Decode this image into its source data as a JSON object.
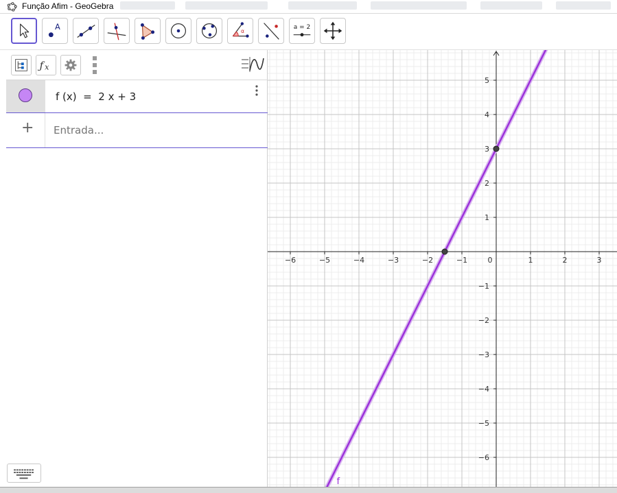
{
  "window": {
    "title": "Função Afim - GeoGebra"
  },
  "toolbar": {
    "tools": [
      "move",
      "point",
      "line",
      "perpendicular-line",
      "polygon",
      "circle-center-point",
      "circle-three-points",
      "angle",
      "reflect-about-line",
      "slider",
      "move-graphics-view"
    ],
    "slider_tool_label": "a = 2"
  },
  "algebra": {
    "objects": [
      {
        "color": "#c586f5",
        "formula": "f (x)  =  2 x + 3"
      }
    ],
    "input_placeholder": "Entrada...",
    "add_symbol": "+"
  },
  "graphics": {
    "function_label": "f",
    "x_ticks": [
      "−6",
      "−5",
      "−4",
      "−3",
      "−2",
      "−1",
      "0",
      "1",
      "2",
      "3"
    ],
    "y_ticks_pos": [
      "5",
      "4",
      "3",
      "2",
      "1"
    ],
    "y_ticks_neg": [
      "−1",
      "−2",
      "−3",
      "−4",
      "−5",
      "−6"
    ],
    "line_color": "#9b30d9",
    "chart_data": {
      "type": "line",
      "function": "2x + 3",
      "slope": 2,
      "intercept": 3,
      "xlim": [
        -6.5,
        3.5
      ],
      "ylim": [
        -6.8,
        5.9
      ],
      "points": [
        {
          "x": 0,
          "y": 3
        },
        {
          "x": -1.5,
          "y": 0
        }
      ]
    }
  }
}
